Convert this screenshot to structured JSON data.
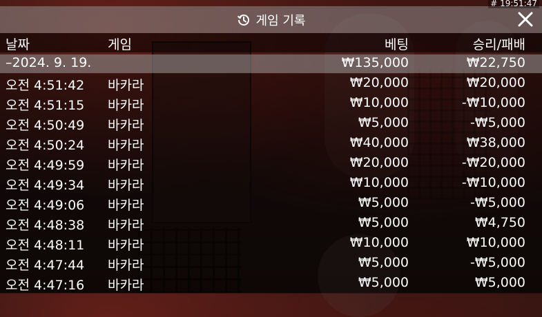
{
  "status": {
    "clock": "# 19:51:47"
  },
  "header": {
    "title": "게임 기록",
    "icon": "history-icon",
    "close_icon": "close-icon"
  },
  "columns": {
    "time": "날짜",
    "game": "게임",
    "bet": "베팅",
    "result": "승리/패배"
  },
  "date_summary": {
    "date": "–2024. 9. 19.",
    "bet": "₩135,000",
    "result": "₩22,750"
  },
  "rows": [
    {
      "time": "오전 4:51:42",
      "game": "바카라",
      "bet": "₩20,000",
      "result": "₩20,000"
    },
    {
      "time": "오전 4:51:15",
      "game": "바카라",
      "bet": "₩10,000",
      "result": "-₩10,000"
    },
    {
      "time": "오전 4:50:49",
      "game": "바카라",
      "bet": "₩5,000",
      "result": "-₩5,000"
    },
    {
      "time": "오전 4:50:24",
      "game": "바카라",
      "bet": "₩40,000",
      "result": "₩38,000"
    },
    {
      "time": "오전 4:49:59",
      "game": "바카라",
      "bet": "₩20,000",
      "result": "-₩20,000"
    },
    {
      "time": "오전 4:49:34",
      "game": "바카라",
      "bet": "₩10,000",
      "result": "-₩10,000"
    },
    {
      "time": "오전 4:49:06",
      "game": "바카라",
      "bet": "₩5,000",
      "result": "-₩5,000"
    },
    {
      "time": "오전 4:48:38",
      "game": "바카라",
      "bet": "₩5,000",
      "result": "₩4,750"
    },
    {
      "time": "오전 4:48:11",
      "game": "바카라",
      "bet": "₩10,000",
      "result": "₩10,000"
    },
    {
      "time": "오전 4:47:44",
      "game": "바카라",
      "bet": "₩5,000",
      "result": "-₩5,000"
    },
    {
      "time": "오전 4:47:16",
      "game": "바카라",
      "bet": "₩5,000",
      "result": "₩5,000"
    }
  ]
}
